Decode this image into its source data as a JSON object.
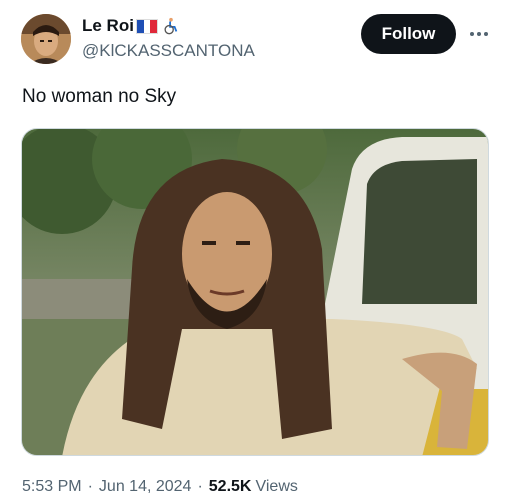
{
  "author": {
    "display_name": "Le Roi",
    "handle": "@KlCKASSCANTONA",
    "avatar_icon": "profile-photo",
    "emoji": [
      "french-flag-icon",
      "wheelchair-icon"
    ]
  },
  "actions": {
    "follow_label": "Follow",
    "more_icon": "more-dots-icon"
  },
  "tweet": {
    "text": "No woman no Sky"
  },
  "media": {
    "kind": "photo"
  },
  "meta": {
    "time": "5:53 PM",
    "separator": "·",
    "date": "Jun 14, 2024",
    "views_count": "52.5K",
    "views_label": "Views"
  }
}
